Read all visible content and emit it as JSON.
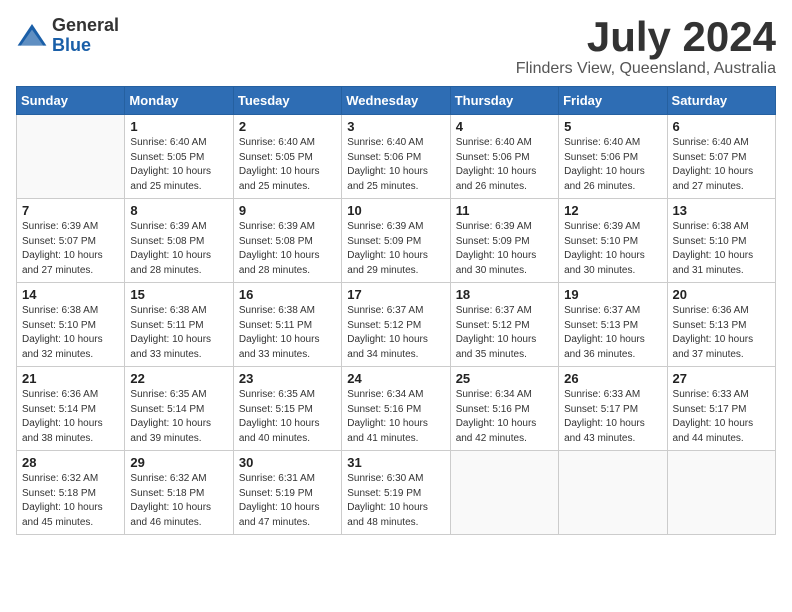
{
  "header": {
    "logo_general": "General",
    "logo_blue": "Blue",
    "month": "July 2024",
    "location": "Flinders View, Queensland, Australia"
  },
  "weekdays": [
    "Sunday",
    "Monday",
    "Tuesday",
    "Wednesday",
    "Thursday",
    "Friday",
    "Saturday"
  ],
  "weeks": [
    [
      {
        "day": "",
        "sunrise": "",
        "sunset": "",
        "daylight": ""
      },
      {
        "day": "1",
        "sunrise": "6:40 AM",
        "sunset": "5:05 PM",
        "daylight": "10 hours and 25 minutes."
      },
      {
        "day": "2",
        "sunrise": "6:40 AM",
        "sunset": "5:05 PM",
        "daylight": "10 hours and 25 minutes."
      },
      {
        "day": "3",
        "sunrise": "6:40 AM",
        "sunset": "5:06 PM",
        "daylight": "10 hours and 25 minutes."
      },
      {
        "day": "4",
        "sunrise": "6:40 AM",
        "sunset": "5:06 PM",
        "daylight": "10 hours and 26 minutes."
      },
      {
        "day": "5",
        "sunrise": "6:40 AM",
        "sunset": "5:06 PM",
        "daylight": "10 hours and 26 minutes."
      },
      {
        "day": "6",
        "sunrise": "6:40 AM",
        "sunset": "5:07 PM",
        "daylight": "10 hours and 27 minutes."
      }
    ],
    [
      {
        "day": "7",
        "sunrise": "6:39 AM",
        "sunset": "5:07 PM",
        "daylight": "10 hours and 27 minutes."
      },
      {
        "day": "8",
        "sunrise": "6:39 AM",
        "sunset": "5:08 PM",
        "daylight": "10 hours and 28 minutes."
      },
      {
        "day": "9",
        "sunrise": "6:39 AM",
        "sunset": "5:08 PM",
        "daylight": "10 hours and 28 minutes."
      },
      {
        "day": "10",
        "sunrise": "6:39 AM",
        "sunset": "5:09 PM",
        "daylight": "10 hours and 29 minutes."
      },
      {
        "day": "11",
        "sunrise": "6:39 AM",
        "sunset": "5:09 PM",
        "daylight": "10 hours and 30 minutes."
      },
      {
        "day": "12",
        "sunrise": "6:39 AM",
        "sunset": "5:10 PM",
        "daylight": "10 hours and 30 minutes."
      },
      {
        "day": "13",
        "sunrise": "6:38 AM",
        "sunset": "5:10 PM",
        "daylight": "10 hours and 31 minutes."
      }
    ],
    [
      {
        "day": "14",
        "sunrise": "6:38 AM",
        "sunset": "5:10 PM",
        "daylight": "10 hours and 32 minutes."
      },
      {
        "day": "15",
        "sunrise": "6:38 AM",
        "sunset": "5:11 PM",
        "daylight": "10 hours and 33 minutes."
      },
      {
        "day": "16",
        "sunrise": "6:38 AM",
        "sunset": "5:11 PM",
        "daylight": "10 hours and 33 minutes."
      },
      {
        "day": "17",
        "sunrise": "6:37 AM",
        "sunset": "5:12 PM",
        "daylight": "10 hours and 34 minutes."
      },
      {
        "day": "18",
        "sunrise": "6:37 AM",
        "sunset": "5:12 PM",
        "daylight": "10 hours and 35 minutes."
      },
      {
        "day": "19",
        "sunrise": "6:37 AM",
        "sunset": "5:13 PM",
        "daylight": "10 hours and 36 minutes."
      },
      {
        "day": "20",
        "sunrise": "6:36 AM",
        "sunset": "5:13 PM",
        "daylight": "10 hours and 37 minutes."
      }
    ],
    [
      {
        "day": "21",
        "sunrise": "6:36 AM",
        "sunset": "5:14 PM",
        "daylight": "10 hours and 38 minutes."
      },
      {
        "day": "22",
        "sunrise": "6:35 AM",
        "sunset": "5:14 PM",
        "daylight": "10 hours and 39 minutes."
      },
      {
        "day": "23",
        "sunrise": "6:35 AM",
        "sunset": "5:15 PM",
        "daylight": "10 hours and 40 minutes."
      },
      {
        "day": "24",
        "sunrise": "6:34 AM",
        "sunset": "5:16 PM",
        "daylight": "10 hours and 41 minutes."
      },
      {
        "day": "25",
        "sunrise": "6:34 AM",
        "sunset": "5:16 PM",
        "daylight": "10 hours and 42 minutes."
      },
      {
        "day": "26",
        "sunrise": "6:33 AM",
        "sunset": "5:17 PM",
        "daylight": "10 hours and 43 minutes."
      },
      {
        "day": "27",
        "sunrise": "6:33 AM",
        "sunset": "5:17 PM",
        "daylight": "10 hours and 44 minutes."
      }
    ],
    [
      {
        "day": "28",
        "sunrise": "6:32 AM",
        "sunset": "5:18 PM",
        "daylight": "10 hours and 45 minutes."
      },
      {
        "day": "29",
        "sunrise": "6:32 AM",
        "sunset": "5:18 PM",
        "daylight": "10 hours and 46 minutes."
      },
      {
        "day": "30",
        "sunrise": "6:31 AM",
        "sunset": "5:19 PM",
        "daylight": "10 hours and 47 minutes."
      },
      {
        "day": "31",
        "sunrise": "6:30 AM",
        "sunset": "5:19 PM",
        "daylight": "10 hours and 48 minutes."
      },
      {
        "day": "",
        "sunrise": "",
        "sunset": "",
        "daylight": ""
      },
      {
        "day": "",
        "sunrise": "",
        "sunset": "",
        "daylight": ""
      },
      {
        "day": "",
        "sunrise": "",
        "sunset": "",
        "daylight": ""
      }
    ]
  ]
}
